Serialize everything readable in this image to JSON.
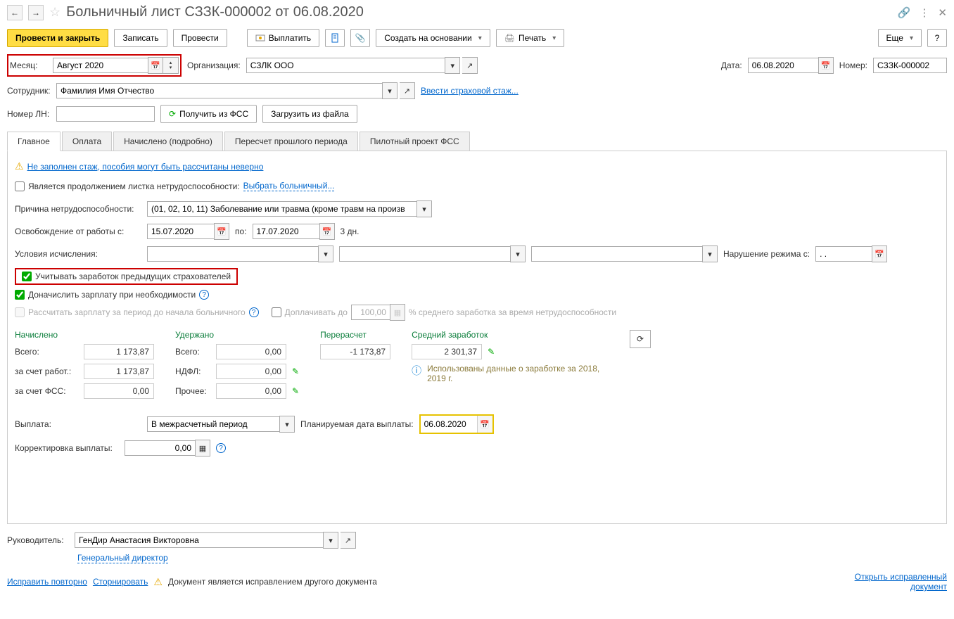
{
  "header": {
    "title": "Больничный лист СЗЗК-000002 от 06.08.2020"
  },
  "toolbar": {
    "post_close": "Провести и закрыть",
    "save": "Записать",
    "post": "Провести",
    "pay": "Выплатить",
    "create_based": "Создать на основании",
    "print": "Печать",
    "more": "Еще"
  },
  "fields": {
    "month_label": "Месяц:",
    "month_value": "Август 2020",
    "org_label": "Организация:",
    "org_value": "СЗЛК ООО",
    "date_label": "Дата:",
    "date_value": "06.08.2020",
    "number_label": "Номер:",
    "number_value": "СЗЗК-000002",
    "employee_label": "Сотрудник:",
    "employee_value": "Фамилия Имя Отчество",
    "insurance_link": "Ввести страховой стаж...",
    "ln_label": "Номер ЛН:",
    "get_fss": "Получить из ФСС",
    "load_file": "Загрузить из файла"
  },
  "tabs": [
    "Главное",
    "Оплата",
    "Начислено (подробно)",
    "Пересчет прошлого периода",
    "Пилотный проект ФСС"
  ],
  "main_tab": {
    "warning": "Не заполнен стаж, пособия могут быть рассчитаны неверно",
    "is_continuation": "Является продолжением листка нетрудоспособности:",
    "select_sick": "Выбрать больничный...",
    "reason_label": "Причина нетрудоспособности:",
    "reason_value": "(01, 02, 10, 11) Заболевание или травма (кроме травм на произв",
    "release_from": "Освобождение от работы с:",
    "date_from": "15.07.2020",
    "to_label": "по:",
    "date_to": "17.07.2020",
    "days": "3 дн.",
    "conditions_label": "Условия исчисления:",
    "violation_label": "Нарушение режима с:",
    "violation_value": ". .",
    "account_prev": "Учитывать заработок предыдущих страхователей",
    "add_salary": "Доначислить зарплату при необходимости",
    "calc_salary": "Рассчитать зарплату за период до начала больничного",
    "pay_up_to": "Доплачивать до",
    "pay_up_val": "100,00",
    "pay_up_note": "% среднего заработка за время нетрудоспособности"
  },
  "summary": {
    "accrued_hdr": "Начислено",
    "withheld_hdr": "Удержано",
    "recalc_hdr": "Перерасчет",
    "avg_hdr": "Средний заработок",
    "total_label": "Всего:",
    "accrued_total": "1 173,87",
    "employer_label": "за счет работ.:",
    "accrued_employer": "1 173,87",
    "fss_label": "за счет ФСС:",
    "accrued_fss": "0,00",
    "withheld_total": "0,00",
    "ndfl_label": "НДФЛ:",
    "ndfl_val": "0,00",
    "other_label": "Прочее:",
    "other_val": "0,00",
    "recalc_val": "-1 173,87",
    "avg_val": "2 301,37",
    "info_text": "Использованы данные о заработке за 2018, 2019 г."
  },
  "payment": {
    "payment_label": "Выплата:",
    "payment_value": "В межрасчетный период",
    "planned_date_label": "Планируемая дата выплаты:",
    "planned_date": "06.08.2020",
    "correction_label": "Корректировка выплаты:",
    "correction_val": "0,00"
  },
  "footer": {
    "manager_label": "Руководитель:",
    "manager_value": "ГенДир Анастасия Викторовна",
    "manager_title": "Генеральный директор",
    "fix_again": "Исправить повторно",
    "storno": "Сторнировать",
    "doc_note": "Документ является исправлением другого документа",
    "open_fixed": "Открыть исправленный документ"
  }
}
